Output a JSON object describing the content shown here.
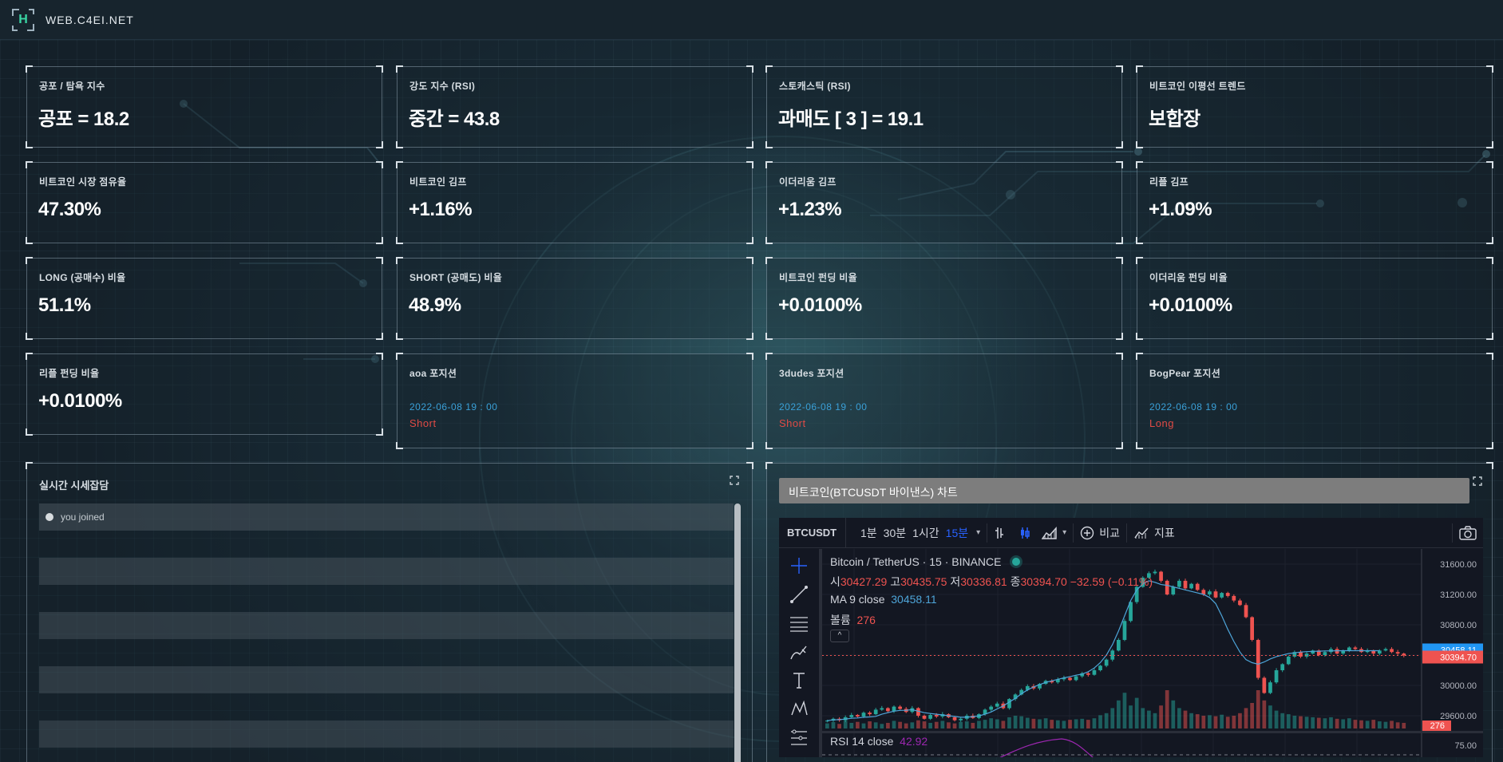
{
  "site": {
    "logo_letter": "H",
    "name": "WEB.C4EI.NET"
  },
  "cards": [
    {
      "label": "공포 / 탐욕 지수",
      "value": "공포 = 18.2"
    },
    {
      "label": "강도 지수 (RSI)",
      "value": "중간 = 43.8"
    },
    {
      "label": "스토캐스틱 (RSI)",
      "value": "과매도 [ 3 ] = 19.1"
    },
    {
      "label": "비트코인 이평선 트렌드",
      "value": "보합장"
    },
    {
      "label": "비트코인 시장 점유율",
      "value": "47.30%"
    },
    {
      "label": "비트코인 김프",
      "value": "+1.16%"
    },
    {
      "label": "이더리움 김프",
      "value": "+1.23%"
    },
    {
      "label": "리플 김프",
      "value": "+1.09%"
    },
    {
      "label": "LONG (공매수) 비율",
      "value": "51.1%"
    },
    {
      "label": "SHORT (공매도) 비율",
      "value": "48.9%"
    },
    {
      "label": "비트코인 펀딩 비율",
      "value": "+0.0100%"
    },
    {
      "label": "이더리움 펀딩 비율",
      "value": "+0.0100%"
    },
    {
      "label": "리플 펀딩 비율",
      "value": "+0.0100%"
    }
  ],
  "positions": [
    {
      "label": "aoa 포지션",
      "date": "2022-06-08   19 : 00",
      "side": "Short"
    },
    {
      "label": "3dudes 포지션",
      "date": "2022-06-08   19 : 00",
      "side": "Short"
    },
    {
      "label": "BogPear 포지션",
      "date": "2022-06-08   19 : 00",
      "side": "Long"
    }
  ],
  "chat": {
    "title": "실시간 시세잡담",
    "message": "you joined"
  },
  "chart_panel": {
    "title": "비트코인(BTCUSDT 바이낸스) 차트"
  },
  "tv": {
    "symbol": "BTCUSDT",
    "intervals": [
      "1분",
      "30분",
      "1시간",
      "15분"
    ],
    "active_interval": "15분",
    "compare_label": "비교",
    "indicators_label": "지표",
    "legend_title": "Bitcoin / TetherUS · 15 · BINANCE",
    "o_label": "시",
    "o": "30427.29",
    "h_label": "고",
    "h": "30435.75",
    "l_label": "저",
    "l": "30336.81",
    "c_label": "종",
    "c": "30394.70",
    "change": "−32.59 (−0.11%)",
    "ma_label": "MA 9 close",
    "ma_value": "30458.11",
    "vol_label": "볼륨",
    "vol_value": "276",
    "rsi_label": "RSI 14 close",
    "rsi_value": "42.92",
    "price_ticks": [
      "31600.00",
      "31200.00",
      "30800.00",
      "30400.00",
      "30000.00",
      "29600.00"
    ],
    "rsi_tick": "75.00",
    "ma_badge": "30458.11",
    "price_badge": "30394.70",
    "vol_badge": "276",
    "colors": {
      "up": "#26a69a",
      "down": "#ef5350",
      "ma": "#4ea5d9",
      "rsi": "#9c27b0"
    }
  },
  "chart_data": {
    "type": "candlestick",
    "title": "Bitcoin / TetherUS · 15 · BINANCE",
    "ylim": [
      29400,
      31800
    ],
    "series": [
      {
        "name": "MA 9 close"
      },
      {
        "name": "볼륨"
      },
      {
        "name": "RSI 14 close"
      }
    ],
    "close": [
      29535,
      29560,
      29540,
      29580,
      29610,
      29590,
      29640,
      29620,
      29680,
      29700,
      29660,
      29720,
      29690,
      29650,
      29700,
      29600,
      29560,
      29610,
      29590,
      29620,
      29580,
      29540,
      29560,
      29600,
      29570,
      29620,
      29680,
      29720,
      29760,
      29700,
      29820,
      29880,
      29940,
      29990,
      29960,
      30020,
      30060,
      30040,
      30080,
      30100,
      30070,
      30120,
      30160,
      30140,
      30200,
      30260,
      30340,
      30460,
      30600,
      30850,
      31100,
      31300,
      31420,
      31480,
      31500,
      31380,
      31200,
      31300,
      31380,
      31280,
      31340,
      31260,
      31200,
      31240,
      31160,
      31220,
      31180,
      31120,
      31060,
      30900,
      30600,
      30100,
      29900,
      30040,
      30200,
      30280,
      30380,
      30440,
      30380,
      30420,
      30460,
      30400,
      30440,
      30480,
      30420,
      30460,
      30500,
      30480,
      30440,
      30460,
      30420,
      30460,
      30480,
      30440,
      30420,
      30394
    ],
    "volume": [
      20,
      25,
      18,
      30,
      22,
      26,
      20,
      28,
      24,
      18,
      22,
      30,
      26,
      20,
      24,
      32,
      28,
      22,
      26,
      30,
      24,
      20,
      26,
      28,
      22,
      30,
      34,
      40,
      36,
      30,
      44,
      50,
      48,
      42,
      38,
      36,
      40,
      34,
      32,
      30,
      34,
      36,
      38,
      34,
      40,
      52,
      60,
      80,
      110,
      140,
      90,
      120,
      80,
      70,
      60,
      90,
      150,
      110,
      80,
      70,
      60,
      56,
      50,
      52,
      48,
      54,
      46,
      50,
      60,
      80,
      100,
      150,
      110,
      90,
      70,
      60,
      56,
      50,
      48,
      46,
      44,
      42,
      40,
      44,
      38,
      36,
      40,
      34,
      32,
      30,
      34,
      28,
      26,
      30,
      24,
      22
    ],
    "ma_9_close": [
      29535,
      29545,
      29548,
      29556,
      29566,
      29570,
      29580,
      29584,
      29592,
      29620,
      29640,
      29660,
      29670,
      29672,
      29680,
      29660,
      29640,
      29630,
      29620,
      29610,
      29600,
      29590,
      29580,
      29580,
      29588,
      29598,
      29620,
      29650,
      29690,
      29730,
      29780,
      29830,
      29890,
      29940,
      29980,
      30010,
      30040,
      30060,
      30080,
      30100,
      30115,
      30135,
      30150,
      30180,
      30230,
      30300,
      30400,
      30540,
      30720,
      30920,
      31120,
      31260,
      31340,
      31380,
      31360,
      31330,
      31320,
      31300,
      31280,
      31260,
      31240,
      31220,
      31200,
      31160,
      31080,
      30920,
      30740,
      30580,
      30440,
      30340,
      30300,
      30280,
      30310,
      30350,
      30380,
      30400,
      30420,
      30430,
      30440,
      30445,
      30450,
      30452,
      30455,
      30456,
      30457,
      30458,
      30458,
      30458,
      30458,
      30458,
      30458,
      30458
    ]
  }
}
